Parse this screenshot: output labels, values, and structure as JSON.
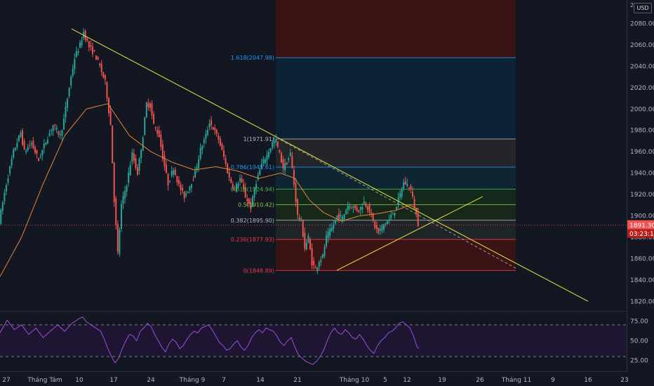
{
  "header": {
    "currency_badge": "USD",
    "scale_top": "2"
  },
  "chart_data": {
    "type": "line",
    "subtype": "candlestick",
    "price_axis": {
      "ticks": [
        2080,
        2060,
        2040,
        2020,
        2000,
        1980,
        1960,
        1940,
        1920,
        1900,
        1880,
        1860,
        1840,
        1820
      ],
      "tick_labels": [
        "2080.00",
        "2060.00",
        "2040.00",
        "2020.00",
        "2000.00",
        "1980.00",
        "1960.00",
        "1940.00",
        "1920.00",
        "1900.00",
        "1880.00",
        "1860.00",
        "1840.00",
        "1820.00"
      ],
      "ylim": [
        1811,
        2102
      ]
    },
    "time_axis": {
      "labels": [
        "27",
        "Tháng Tám",
        "10",
        "17",
        "24",
        "Tháng 9",
        "7",
        "14",
        "21",
        "Tháng 10",
        "5",
        "12",
        "19",
        "26",
        "Tháng 11",
        "9",
        "16",
        "23"
      ]
    },
    "current_price": {
      "value": 1891.3,
      "label": "1891.30",
      "countdown": "03:23:14"
    },
    "price_path": [
      [
        0,
        1895
      ],
      [
        4,
        1930
      ],
      [
        8,
        1960
      ],
      [
        12,
        1978
      ],
      [
        14,
        1960
      ],
      [
        18,
        1968
      ],
      [
        22,
        1952
      ],
      [
        26,
        1970
      ],
      [
        30,
        1985
      ],
      [
        34,
        1975
      ],
      [
        36,
        1990
      ],
      [
        40,
        2030
      ],
      [
        42,
        2048
      ],
      [
        45,
        2060
      ],
      [
        47,
        2072
      ],
      [
        50,
        2058
      ],
      [
        53,
        2052
      ],
      [
        56,
        2040
      ],
      [
        59,
        2025
      ],
      [
        62,
        1985
      ],
      [
        64,
        1915
      ],
      [
        66,
        1865
      ],
      [
        68,
        1910
      ],
      [
        71,
        1930
      ],
      [
        74,
        1958
      ],
      [
        77,
        1940
      ],
      [
        80,
        1975
      ],
      [
        82,
        2005
      ],
      [
        84,
        2003
      ],
      [
        86,
        1985
      ],
      [
        89,
        1975
      ],
      [
        91,
        1955
      ],
      [
        94,
        1930
      ],
      [
        97,
        1945
      ],
      [
        100,
        1928
      ],
      [
        103,
        1918
      ],
      [
        106,
        1928
      ],
      [
        109,
        1940
      ],
      [
        112,
        1962
      ],
      [
        115,
        1975
      ],
      [
        117,
        1988
      ],
      [
        119,
        1982
      ],
      [
        122,
        1972
      ],
      [
        125,
        1955
      ],
      [
        128,
        1935
      ],
      [
        131,
        1925
      ],
      [
        134,
        1935
      ],
      [
        137,
        1918
      ],
      [
        140,
        1908
      ],
      [
        143,
        1932
      ],
      [
        146,
        1948
      ],
      [
        149,
        1957
      ],
      [
        152,
        1968
      ],
      [
        154,
        1970
      ],
      [
        156,
        1958
      ],
      [
        158,
        1945
      ],
      [
        160,
        1950
      ],
      [
        162,
        1958
      ],
      [
        164,
        1930
      ],
      [
        166,
        1900
      ],
      [
        168,
        1895
      ],
      [
        170,
        1870
      ],
      [
        172,
        1880
      ],
      [
        174,
        1856
      ],
      [
        176,
        1850
      ],
      [
        178,
        1858
      ],
      [
        180,
        1862
      ],
      [
        182,
        1880
      ],
      [
        185,
        1888
      ],
      [
        188,
        1900
      ],
      [
        191,
        1898
      ],
      [
        194,
        1910
      ],
      [
        197,
        1908
      ],
      [
        200,
        1905
      ],
      [
        203,
        1913
      ],
      [
        206,
        1905
      ],
      [
        209,
        1890
      ],
      [
        211,
        1884
      ],
      [
        214,
        1892
      ],
      [
        217,
        1897
      ],
      [
        220,
        1905
      ],
      [
        223,
        1920
      ],
      [
        225,
        1931
      ],
      [
        227,
        1929
      ],
      [
        229,
        1925
      ],
      [
        231,
        1908
      ],
      [
        233,
        1893
      ]
    ],
    "path_x_range": [
      0,
      233
    ],
    "ema_path": [
      [
        0,
        1843
      ],
      [
        12,
        1880
      ],
      [
        24,
        1930
      ],
      [
        36,
        1975
      ],
      [
        48,
        2000
      ],
      [
        60,
        2005
      ],
      [
        72,
        1975
      ],
      [
        84,
        1960
      ],
      [
        96,
        1950
      ],
      [
        108,
        1943
      ],
      [
        120,
        1946
      ],
      [
        132,
        1942
      ],
      [
        144,
        1935
      ],
      [
        156,
        1940
      ],
      [
        164,
        1935
      ],
      [
        172,
        1915
      ],
      [
        180,
        1903
      ],
      [
        190,
        1895
      ],
      [
        200,
        1900
      ],
      [
        210,
        1902
      ],
      [
        220,
        1905
      ],
      [
        228,
        1910
      ],
      [
        233,
        1906
      ]
    ],
    "fibonacci": {
      "levels": [
        {
          "ratio": "0",
          "value": 1848.89,
          "label": "0(1848.89)",
          "color": "#f23645"
        },
        {
          "ratio": "0.236",
          "value": 1877.93,
          "label": "0.236(1877.93)",
          "color": "#f23645"
        },
        {
          "ratio": "0.382",
          "value": 1895.9,
          "label": "0.382(1895.90)",
          "color": "#b2b5be"
        },
        {
          "ratio": "0.5",
          "value": 1910.42,
          "label": "0.5(1910.42)",
          "color": "#8bc34a"
        },
        {
          "ratio": "0.618",
          "value": 1924.94,
          "label": "0.618(1924.94)",
          "color": "#4caf50"
        },
        {
          "ratio": "0.786",
          "value": 1945.61,
          "label": "0.786(1945.61)",
          "color": "#2196f3"
        },
        {
          "ratio": "1",
          "value": 1971.91,
          "label": "1(1971.91)",
          "color": "#b2b5be"
        },
        {
          "ratio": "1.618",
          "value": 2047.98,
          "label": "1.618(2047.98)",
          "color": "#2196f3"
        }
      ]
    },
    "rsi": {
      "ticks": [
        75,
        50,
        25
      ],
      "tick_labels": [
        "75.00",
        "50.00",
        "25.00"
      ],
      "upper": 70,
      "lower": 30,
      "ylim": [
        15,
        85
      ],
      "values": [
        [
          0,
          60
        ],
        [
          4,
          76
        ],
        [
          8,
          64
        ],
        [
          12,
          70
        ],
        [
          16,
          58
        ],
        [
          20,
          66
        ],
        [
          24,
          54
        ],
        [
          28,
          62
        ],
        [
          32,
          70
        ],
        [
          36,
          62
        ],
        [
          40,
          72
        ],
        [
          44,
          78
        ],
        [
          46,
          80
        ],
        [
          48,
          74
        ],
        [
          52,
          68
        ],
        [
          56,
          62
        ],
        [
          58,
          52
        ],
        [
          60,
          40
        ],
        [
          62,
          30
        ],
        [
          64,
          22
        ],
        [
          66,
          28
        ],
        [
          68,
          40
        ],
        [
          70,
          50
        ],
        [
          72,
          58
        ],
        [
          74,
          56
        ],
        [
          76,
          50
        ],
        [
          78,
          62
        ],
        [
          80,
          66
        ],
        [
          82,
          72
        ],
        [
          84,
          68
        ],
        [
          86,
          58
        ],
        [
          88,
          50
        ],
        [
          90,
          42
        ],
        [
          92,
          36
        ],
        [
          94,
          46
        ],
        [
          96,
          52
        ],
        [
          98,
          48
        ],
        [
          100,
          40
        ],
        [
          102,
          44
        ],
        [
          104,
          52
        ],
        [
          106,
          58
        ],
        [
          108,
          62
        ],
        [
          110,
          60
        ],
        [
          112,
          66
        ],
        [
          114,
          68
        ],
        [
          116,
          70
        ],
        [
          118,
          64
        ],
        [
          120,
          56
        ],
        [
          122,
          48
        ],
        [
          124,
          44
        ],
        [
          126,
          38
        ],
        [
          128,
          40
        ],
        [
          130,
          46
        ],
        [
          132,
          50
        ],
        [
          134,
          42
        ],
        [
          136,
          38
        ],
        [
          138,
          44
        ],
        [
          140,
          54
        ],
        [
          142,
          60
        ],
        [
          144,
          64
        ],
        [
          146,
          60
        ],
        [
          148,
          66
        ],
        [
          150,
          64
        ],
        [
          152,
          62
        ],
        [
          154,
          56
        ],
        [
          156,
          48
        ],
        [
          158,
          44
        ],
        [
          160,
          50
        ],
        [
          162,
          54
        ],
        [
          164,
          42
        ],
        [
          166,
          32
        ],
        [
          168,
          28
        ],
        [
          170,
          24
        ],
        [
          172,
          22
        ],
        [
          174,
          20
        ],
        [
          176,
          24
        ],
        [
          178,
          30
        ],
        [
          180,
          38
        ],
        [
          182,
          50
        ],
        [
          184,
          60
        ],
        [
          186,
          66
        ],
        [
          188,
          60
        ],
        [
          190,
          58
        ],
        [
          192,
          64
        ],
        [
          194,
          60
        ],
        [
          196,
          54
        ],
        [
          198,
          52
        ],
        [
          200,
          58
        ],
        [
          202,
          52
        ],
        [
          204,
          44
        ],
        [
          206,
          38
        ],
        [
          208,
          34
        ],
        [
          210,
          44
        ],
        [
          212,
          50
        ],
        [
          214,
          54
        ],
        [
          216,
          60
        ],
        [
          218,
          62
        ],
        [
          220,
          66
        ],
        [
          222,
          72
        ],
        [
          224,
          74
        ],
        [
          226,
          70
        ],
        [
          228,
          66
        ],
        [
          230,
          56
        ],
        [
          232,
          42
        ],
        [
          233,
          40
        ]
      ]
    }
  }
}
